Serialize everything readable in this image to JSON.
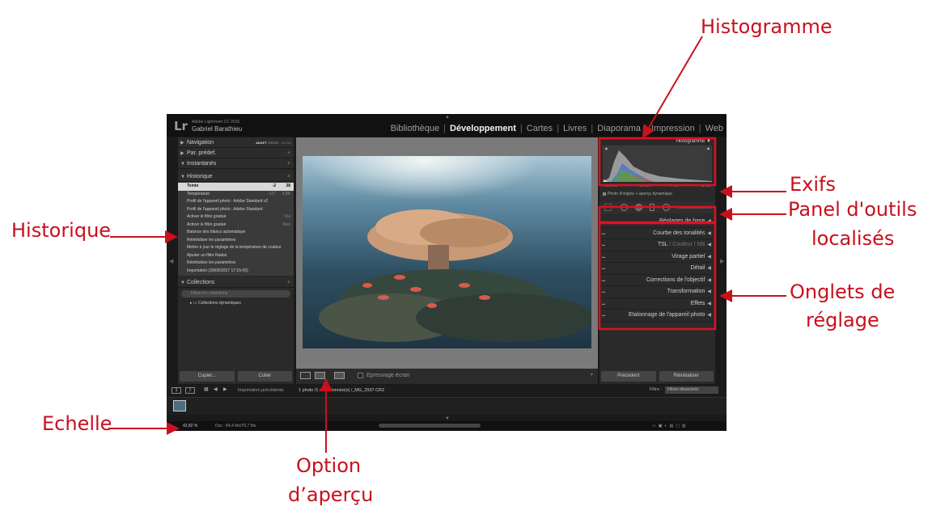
{
  "window": {
    "logo": "Lr",
    "version": "Adobe Lightroom CC 2015",
    "user": "Gabriel Barathieu"
  },
  "modules": [
    {
      "label": "Bibliothèque",
      "active": false
    },
    {
      "label": "Développement",
      "active": true
    },
    {
      "label": "Cartes",
      "active": false
    },
    {
      "label": "Livres",
      "active": false
    },
    {
      "label": "Diaporama",
      "active": false
    },
    {
      "label": "Impression",
      "active": false
    },
    {
      "label": "Web",
      "active": false
    }
  ],
  "left_panel": {
    "navigation": {
      "title": "Navigation",
      "modes": [
        "ADAPT.",
        "REMPL.",
        "1:1",
        "3:1"
      ]
    },
    "presets": {
      "title": "Par. prédef.",
      "action": "+"
    },
    "snapshots": {
      "title": "Instantanés",
      "action": "+"
    },
    "history": {
      "title": "Historique",
      "action": "×",
      "items": [
        {
          "label": "Teinte",
          "v1": "-2",
          "v2": "28",
          "selected": true
        },
        {
          "label": "Température",
          "v1": "-137",
          "v2": "5,8K",
          "selected": false
        },
        {
          "label": "Profil de l'appareil photo : Adobe Standard v2",
          "v1": "",
          "v2": "",
          "selected": false
        },
        {
          "label": "Profil de l'appareil photo : Adobe Standard",
          "v1": "",
          "v2": "",
          "selected": false
        },
        {
          "label": "Activer le filtre gradué",
          "v1": "",
          "v2": "Oui",
          "selected": false
        },
        {
          "label": "Activer le filtre gradué",
          "v1": "",
          "v2": "Non",
          "selected": false
        },
        {
          "label": "Balance des blancs automatique",
          "v1": "",
          "v2": "",
          "selected": false
        },
        {
          "label": "Réinitialiser les paramètres",
          "v1": "",
          "v2": "",
          "selected": false
        },
        {
          "label": "Mettre à jour le réglage de la température de couleur",
          "v1": "",
          "v2": "",
          "selected": false
        },
        {
          "label": "Ajouter un filtre Radial",
          "v1": "",
          "v2": "",
          "selected": false
        },
        {
          "label": "Réinitialiser les paramètres",
          "v1": "",
          "v2": "",
          "selected": false
        },
        {
          "label": "Importation (29/09/2017 17:15:43)",
          "v1": "",
          "v2": "",
          "selected": false
        }
      ]
    },
    "collections": {
      "title": "Collections",
      "action": "+",
      "search_placeholder": "Filtrer les collections",
      "items": [
        "Collections dynamiques"
      ]
    },
    "copy_button": "Copier...",
    "paste_button": "Coller"
  },
  "toolbar": {
    "proof_label": "Epreuvage écran"
  },
  "right_panel": {
    "histogram_title": "Histogramme",
    "exif": {
      "iso": "ISO 100",
      "focal": "16 mm",
      "aperture": "f / 14",
      "shutter": "1/ sec"
    },
    "original_label": "Photo d'origine + aperçu dynamique",
    "adjust_tabs": [
      "Réglages de base",
      "Courbe des tonalités",
      "TSL",
      "Virage partiel",
      "Détail",
      "Corrections de l'objectif",
      "Transformation",
      "Effets",
      "Etalonnage de l'appareil photo"
    ],
    "tsl_extra": [
      "Couleur",
      "NB"
    ],
    "prev_button": "Précédent",
    "reset_button": "Réinitialiser"
  },
  "filmstrip": {
    "pages": [
      "1",
      "2"
    ],
    "source": "Importation précédente",
    "selection": "1 photo /1 sélectionnée(s) /_MG_2937.CR2",
    "filter_label": "Filtre :",
    "filter_value": "Filtres désactivés"
  },
  "status": {
    "zoom": "42,82 %",
    "doc": "Doc : 84,4 Mo/70,7 Mo"
  },
  "annotations": {
    "histogramme": "Histogramme",
    "exifs": "Exifs",
    "panel_outils_1": "Panel d'outils",
    "panel_outils_2": "localisés",
    "historique": "Historique",
    "onglets_1": "Onglets de",
    "onglets_2": "réglage",
    "echelle": "Echelle",
    "option_1": "Option",
    "option_2": "d’aperçu"
  },
  "colors": {
    "annotation": "#c8101e",
    "panel_bg": "#2a2a2a",
    "preview_bg": "#7a7a7a"
  }
}
